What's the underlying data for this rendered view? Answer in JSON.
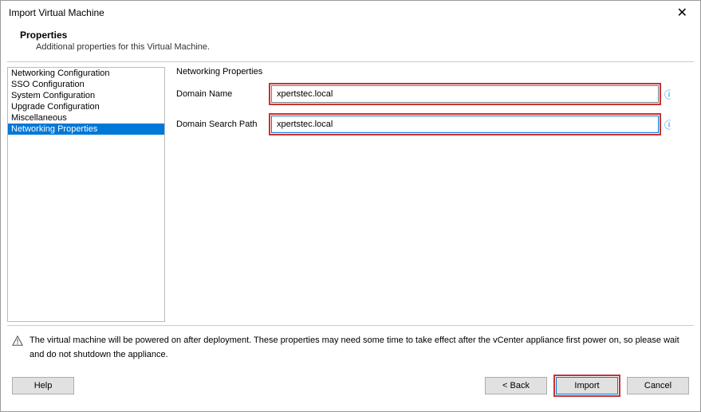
{
  "window": {
    "title": "Import Virtual Machine"
  },
  "header": {
    "title": "Properties",
    "subtitle": "Additional properties for this Virtual Machine."
  },
  "sidebar": {
    "items": [
      {
        "label": "Networking Configuration",
        "selected": false
      },
      {
        "label": "SSO Configuration",
        "selected": false
      },
      {
        "label": "System Configuration",
        "selected": false
      },
      {
        "label": "Upgrade Configuration",
        "selected": false
      },
      {
        "label": "Miscellaneous",
        "selected": false
      },
      {
        "label": "Networking Properties",
        "selected": true
      }
    ]
  },
  "content": {
    "section_title": "Networking Properties",
    "fields": {
      "domain_name": {
        "label": "Domain Name",
        "value": "xpertstec.local"
      },
      "domain_search_path": {
        "label": "Domain Search Path",
        "value": "xpertstec.local"
      }
    }
  },
  "warning": {
    "text": "The virtual machine will be powered on after deployment. These properties may need some time to take effect after the vCenter appliance first power on, so please wait and do not shutdown the appliance."
  },
  "buttons": {
    "help": "Help",
    "back": "< Back",
    "import": "Import",
    "cancel": "Cancel"
  }
}
